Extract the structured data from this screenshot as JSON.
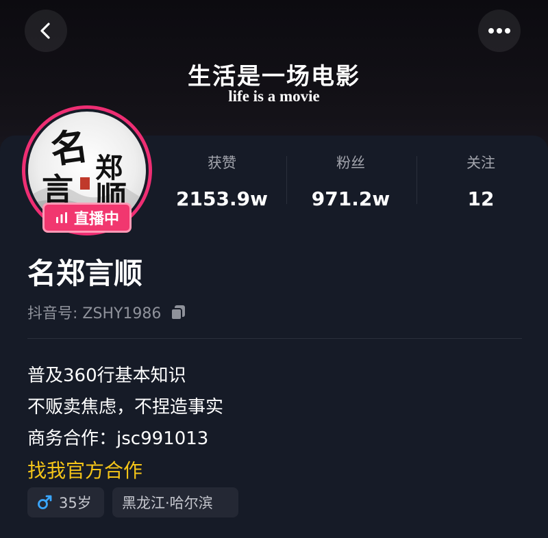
{
  "header": {
    "title": "生活是一场电影",
    "subtitle": "life is a movie",
    "back_icon": "chevron-left-icon",
    "more_icon": "more-dots-icon"
  },
  "profile": {
    "live_badge": "直播中",
    "avatar_text": "名郑言顺",
    "nickname": "名郑言顺",
    "id_label": "抖音号: ZSHY1986",
    "copy_icon": "copy-icon"
  },
  "stats": [
    {
      "label": "获赞",
      "value": "2153.9w"
    },
    {
      "label": "粉丝",
      "value": "971.2w"
    },
    {
      "label": "关注",
      "value": "12"
    }
  ],
  "bio": {
    "lines": [
      "普及360行基本知识",
      "不贩卖焦虑，不捏造事实",
      "商务合作：jsc991013"
    ],
    "cta": "找我官方合作"
  },
  "tags": [
    {
      "icon": "male-icon",
      "text": "35岁"
    },
    {
      "text": "黑龙江·哈尔滨"
    }
  ],
  "colors": {
    "accent_pink": "#ee2e73",
    "cta_yellow": "#f5c518",
    "male_blue": "#3aa7ff",
    "card_bg": "#161b27"
  }
}
